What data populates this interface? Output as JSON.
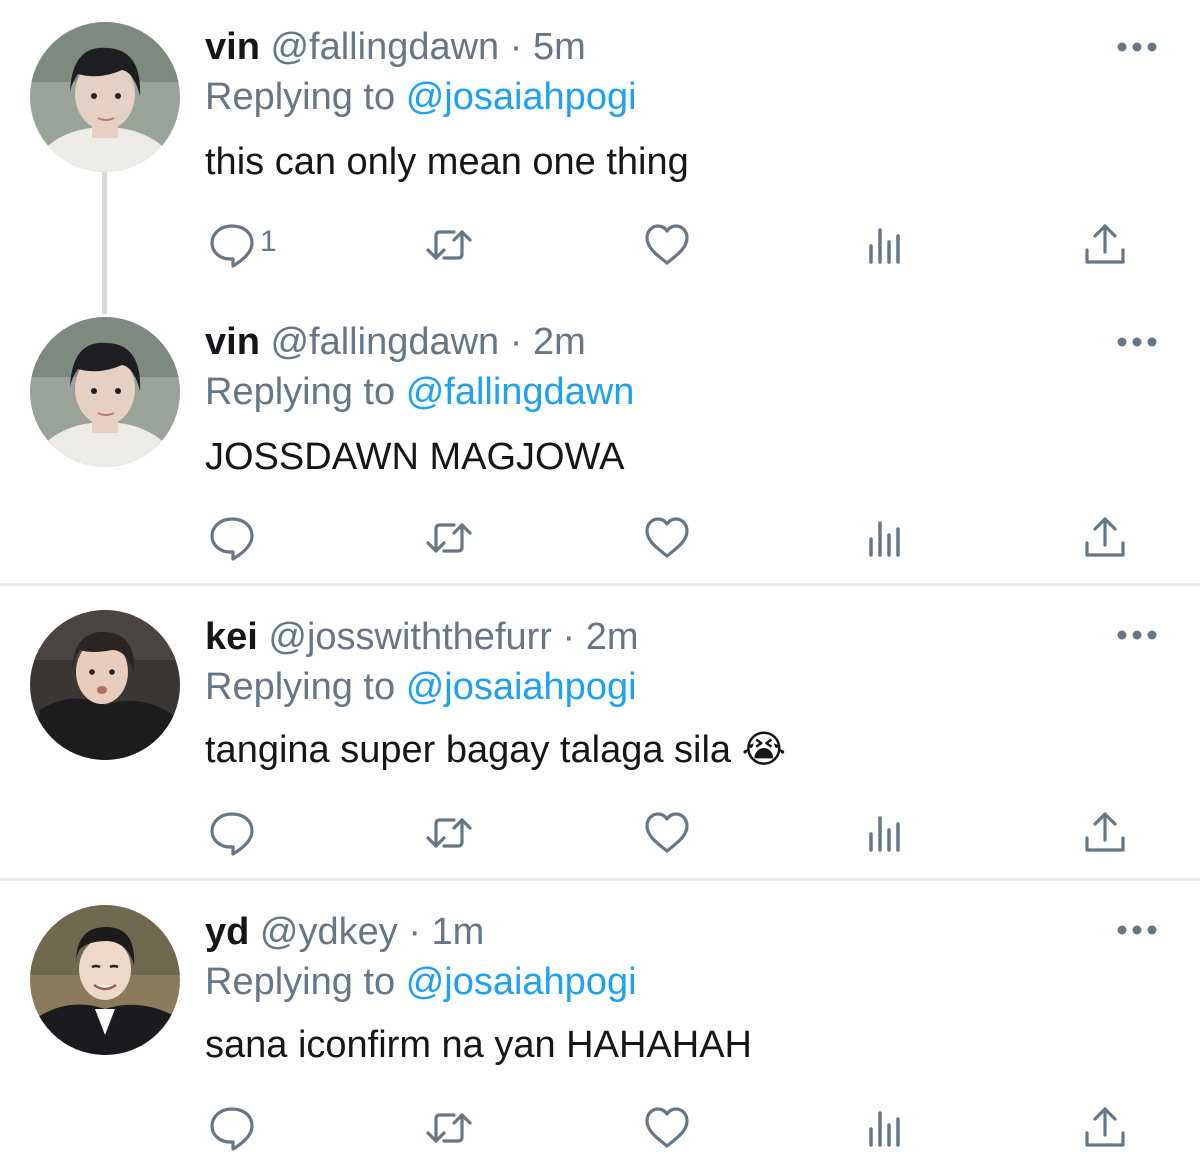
{
  "tweets": [
    {
      "name": "vin",
      "handle": "@fallingdawn",
      "time": "5m",
      "replying_prefix": "Replying to",
      "replying_to": "@josaiahpogi",
      "text": "this can only mean one thing",
      "reply_count": "1",
      "avatar_colors": {
        "bg": "#9aa39a",
        "hair": "#1e1e22",
        "skin": "#e6d0c3",
        "shirt": "#ecebe7"
      }
    },
    {
      "name": "vin",
      "handle": "@fallingdawn",
      "time": "2m",
      "replying_prefix": "Replying to",
      "replying_to": "@fallingdawn",
      "text": "JOSSDAWN MAGJOWA",
      "reply_count": "",
      "avatar_colors": {
        "bg": "#9aa39a",
        "hair": "#1e1e22",
        "skin": "#e6d0c3",
        "shirt": "#ecebe7"
      }
    },
    {
      "name": "kei",
      "handle": "@josswiththefurr",
      "time": "2m",
      "replying_prefix": "Replying to",
      "replying_to": "@josaiahpogi",
      "text": "tangina super bagay talaga sila",
      "emoji": "😭",
      "reply_count": "",
      "avatar_colors": {
        "bg": "#3a3633",
        "hair": "#2a2523",
        "skin": "#e8cdbd",
        "shirt": "#1c1c1f"
      }
    },
    {
      "name": "yd",
      "handle": "@ydkey",
      "time": "1m",
      "replying_prefix": "Replying to",
      "replying_to": "@josaiahpogi",
      "text": "sana iconfirm na yan HAHAHAH",
      "reply_count": "",
      "avatar_colors": {
        "bg": "#8c7a5c",
        "hair": "#1c1a1a",
        "skin": "#eed9c8",
        "shirt": "#1a1a1f"
      }
    }
  ],
  "icons": {
    "reply": "reply-icon",
    "retweet": "retweet-icon",
    "like": "heart-icon",
    "analytics": "analytics-icon",
    "share": "share-icon",
    "more": "more-icon"
  },
  "colors": {
    "text": "#14171a",
    "secondary": "#657786",
    "link": "#1da1f2",
    "divider": "#e6ecf0",
    "thread_line": "#d4d9de"
  }
}
